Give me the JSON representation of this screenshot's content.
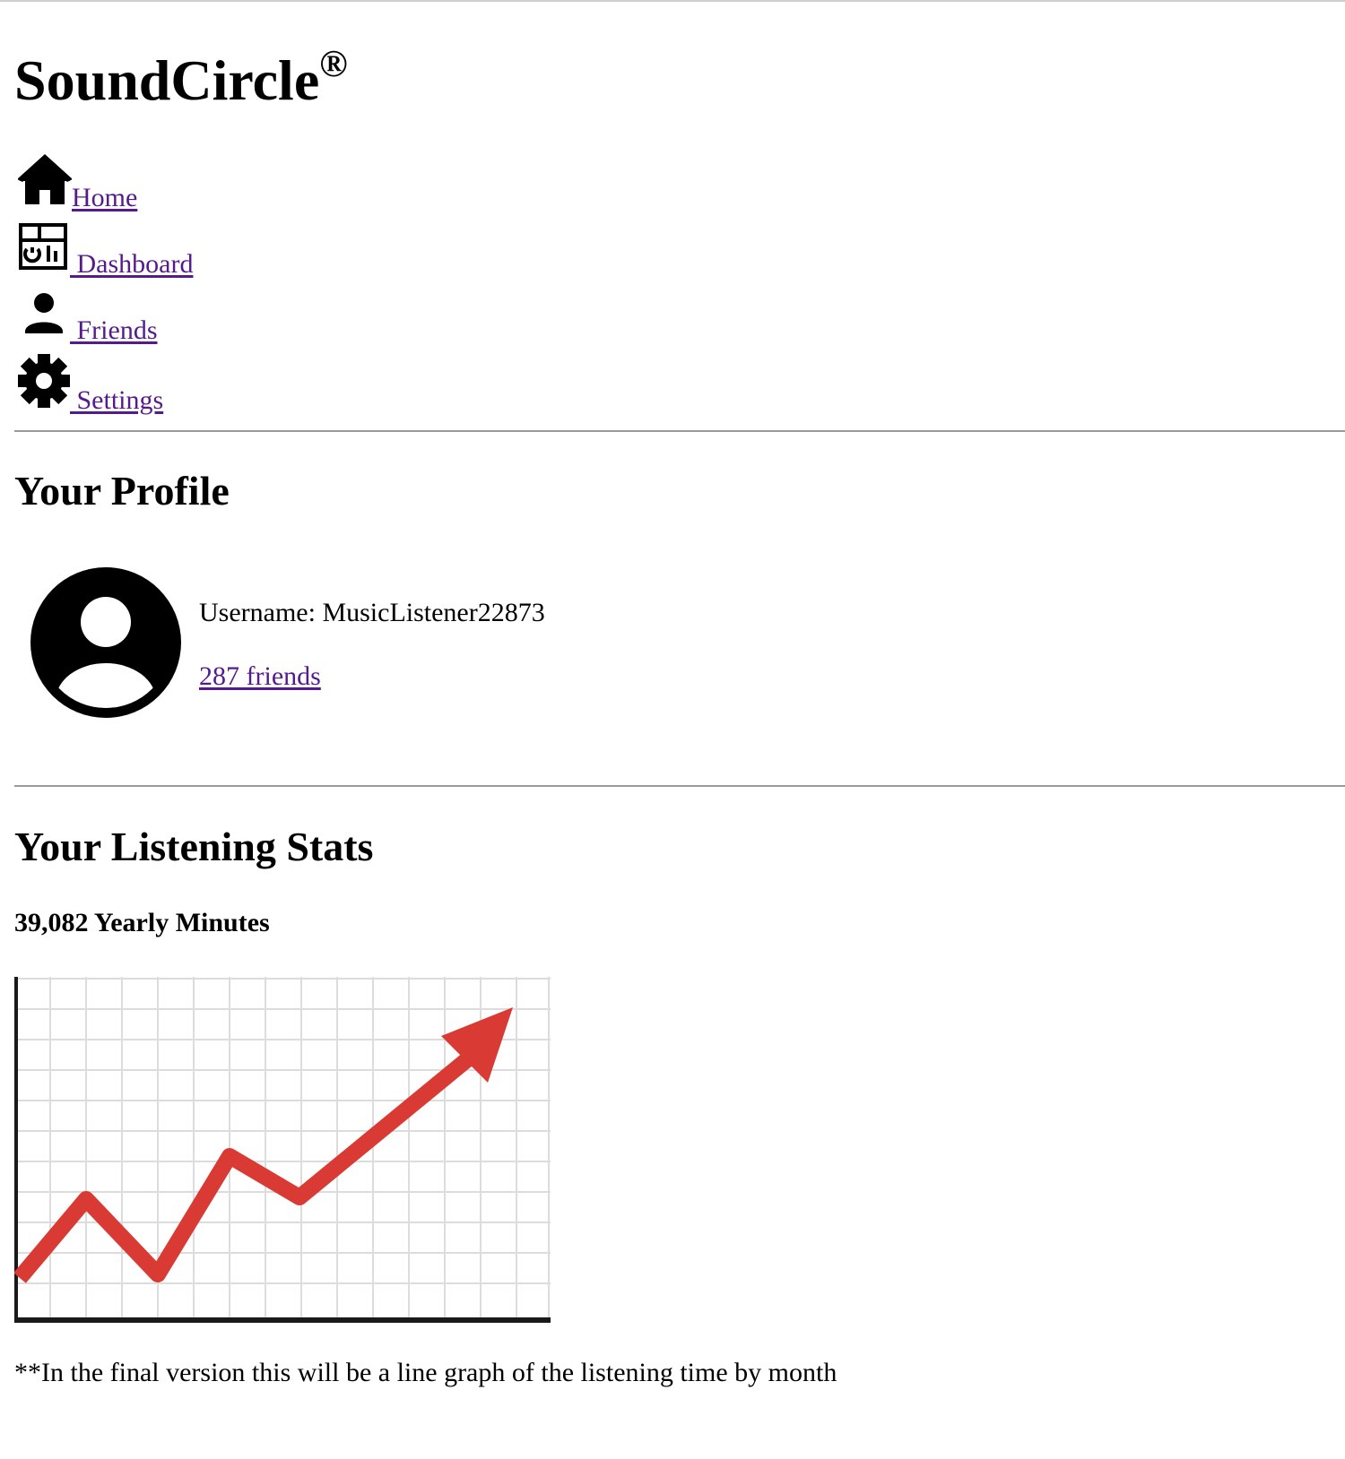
{
  "app": {
    "title": "SoundCircle",
    "registered_mark": "®"
  },
  "nav": {
    "items": [
      {
        "label": "Home",
        "icon": "home-icon"
      },
      {
        "label": " Dashboard",
        "icon": "dashboard-icon"
      },
      {
        "label": " Friends",
        "icon": "person-icon"
      },
      {
        "label": " Settings",
        "icon": "gear-icon"
      }
    ]
  },
  "profile": {
    "heading": "Your Profile",
    "avatar_icon": "account-circle-icon",
    "username_line": "Username: MusicListener22873",
    "friends_link": "287 friends"
  },
  "stats": {
    "heading": "Your Listening Stats",
    "yearly_minutes": "39,082 Yearly Minutes",
    "chart_image_icon": "trending-up-chart-icon",
    "footnote": "**In the final version this will be a line graph of the listening time by month"
  },
  "colors": {
    "link": "#551a8b",
    "trend_arrow": "#d93a33"
  }
}
